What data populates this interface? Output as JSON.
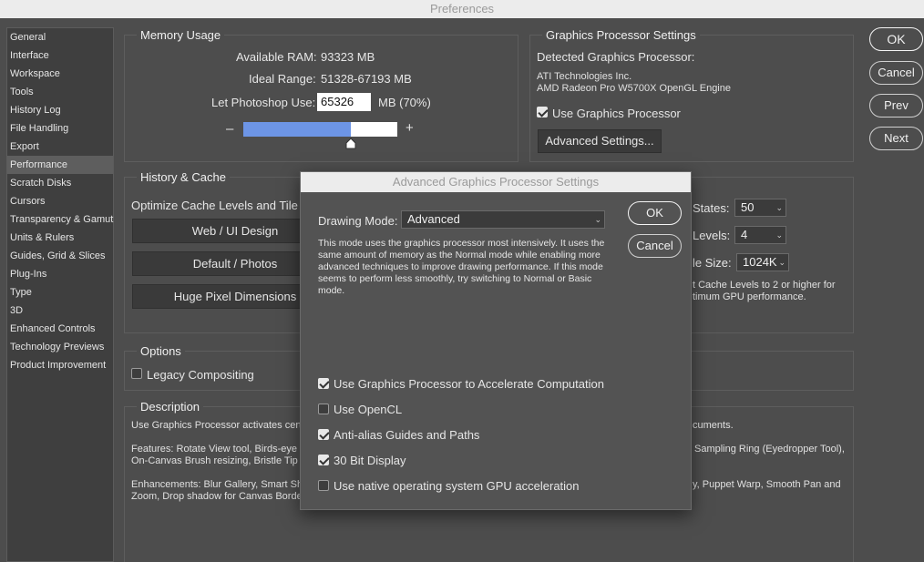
{
  "window": {
    "title": "Preferences"
  },
  "sidebar": {
    "items": [
      {
        "label": "General"
      },
      {
        "label": "Interface"
      },
      {
        "label": "Workspace"
      },
      {
        "label": "Tools"
      },
      {
        "label": "History Log"
      },
      {
        "label": "File Handling"
      },
      {
        "label": "Export"
      },
      {
        "label": "Performance",
        "active": true
      },
      {
        "label": "Scratch Disks"
      },
      {
        "label": "Cursors"
      },
      {
        "label": "Transparency & Gamut"
      },
      {
        "label": "Units & Rulers"
      },
      {
        "label": "Guides, Grid & Slices"
      },
      {
        "label": "Plug-Ins"
      },
      {
        "label": "Type"
      },
      {
        "label": "3D"
      },
      {
        "label": "Enhanced Controls"
      },
      {
        "label": "Technology Previews"
      },
      {
        "label": "Product Improvement"
      }
    ]
  },
  "buttons": {
    "ok": "OK",
    "cancel": "Cancel",
    "prev": "Prev",
    "next": "Next"
  },
  "memory": {
    "title": "Memory Usage",
    "available_label": "Available RAM:",
    "available_value": "93323 MB",
    "ideal_label": "Ideal Range:",
    "ideal_value": "51328-67193 MB",
    "let_label": "Let Photoshop Use:",
    "let_value": "65326",
    "let_unit": "MB (70%)",
    "slider_minus": "–",
    "slider_plus": "+",
    "slider_fraction": 0.7
  },
  "gpu": {
    "title": "Graphics Processor Settings",
    "detected_label": "Detected Graphics Processor:",
    "vendor": "ATI Technologies Inc.",
    "model": "AMD Radeon Pro W5700X OpenGL Engine",
    "use_label": "Use Graphics Processor",
    "use_checked": true,
    "advanced_button": "Advanced Settings..."
  },
  "history": {
    "title": "History & Cache",
    "optimize_label": "Optimize Cache Levels and Tile S",
    "preset1": "Web / UI Design",
    "preset2": "Default / Photos",
    "preset3": "Huge Pixel Dimensions",
    "states_label": "States:",
    "states_value": "50",
    "levels_label": "Levels:",
    "levels_value": "4",
    "tile_label": "le Size:",
    "tile_value": "1024K",
    "note1": "t Cache Levels to 2 or higher for",
    "note2": "timum GPU performance."
  },
  "options": {
    "title": "Options",
    "legacy_label": "Legacy Compositing",
    "legacy_checked": false
  },
  "description": {
    "title": "Description",
    "line1a": "Use Graphics Processor activates cert",
    "line1b": "cuments.",
    "line2a": "Features: Rotate View tool, Birds-eye Z",
    "line2b": "Sampling Ring (Eyedropper Tool),",
    "line3a": "On-Canvas Brush resizing, Bristle Tip P",
    "line4a": "Enhancements: Blur Gallery, Smart Sha",
    "line4b": "y, Puppet Warp, Smooth Pan and",
    "line5a": "Zoom, Drop shadow for Canvas Border"
  },
  "dialog": {
    "title": "Advanced Graphics Processor Settings",
    "mode_label": "Drawing Mode:",
    "mode_value": "Advanced",
    "mode_description": "This mode uses the graphics processor most intensively.  It uses the same amount of memory as the Normal mode while enabling more advanced techniques to improve drawing performance.  If this mode seems to perform less smoothly, try switching to Normal or Basic mode.",
    "ok": "OK",
    "cancel": "Cancel",
    "options": [
      {
        "label": "Use Graphics Processor to Accelerate Computation",
        "checked": true
      },
      {
        "label": "Use OpenCL",
        "checked": false
      },
      {
        "label": "Anti-alias Guides and Paths",
        "checked": true
      },
      {
        "label": "30 Bit Display",
        "checked": true
      },
      {
        "label": "Use native operating system GPU acceleration",
        "checked": false
      }
    ]
  },
  "colors": {
    "background": "#4d4d4d",
    "slider_fill": "#6d95e6",
    "titlebar": "#ececec"
  }
}
